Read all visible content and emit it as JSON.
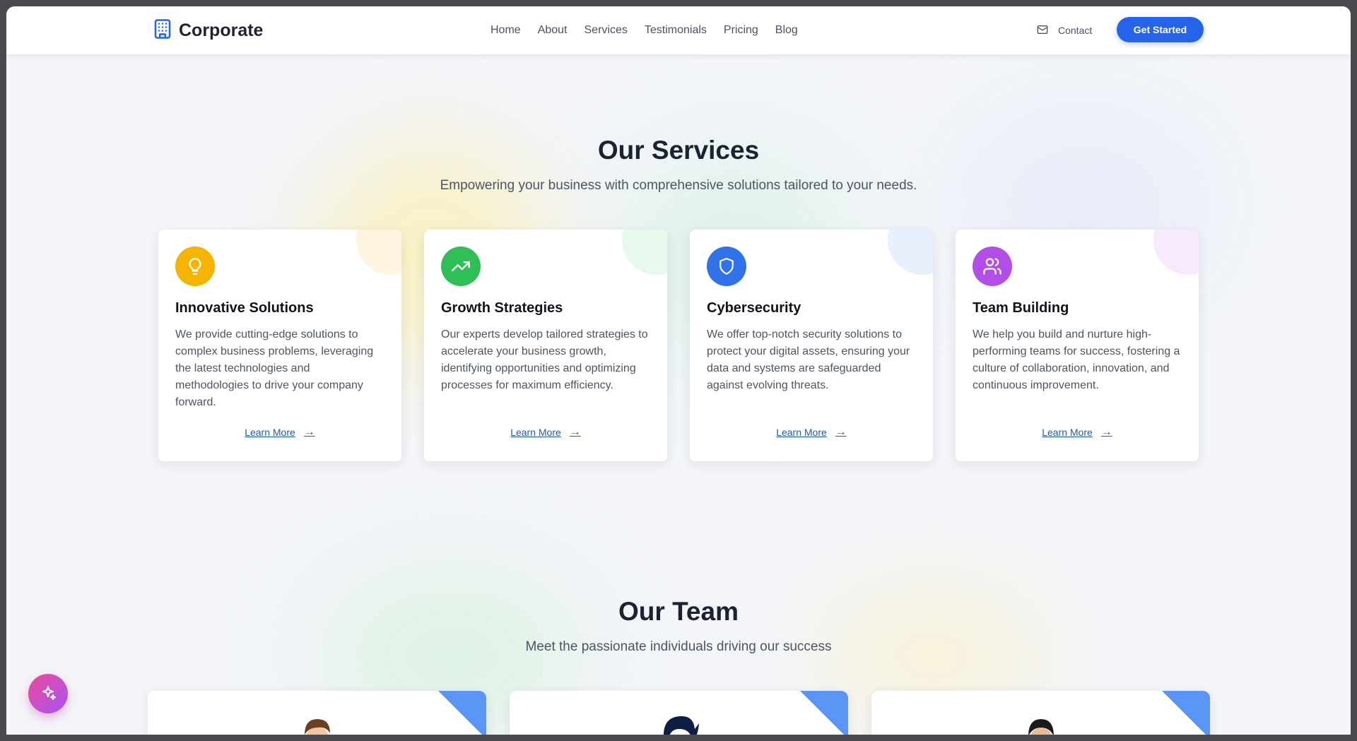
{
  "brand": {
    "name": "Corporate",
    "icon": "building-icon"
  },
  "nav": [
    {
      "label": "Home"
    },
    {
      "label": "About"
    },
    {
      "label": "Services"
    },
    {
      "label": "Testimonials"
    },
    {
      "label": "Pricing"
    },
    {
      "label": "Blog"
    }
  ],
  "contact": {
    "label": "Contact",
    "icon": "mail-icon"
  },
  "cta": {
    "label": "Get Started"
  },
  "services": {
    "title": "Our Services",
    "subtitle": "Empowering your business with comprehensive solutions tailored to your needs.",
    "cards": [
      {
        "icon": "lightbulb-icon",
        "color": "#f5b400",
        "title": "Innovative Solutions",
        "description": "We provide cutting-edge solutions to complex business problems, leveraging the latest technologies and methodologies to drive your company forward.",
        "link": "Learn More"
      },
      {
        "icon": "trending-up-icon",
        "color": "#2fbf57",
        "title": "Growth Strategies",
        "description": "Our experts develop tailored strategies to accelerate your business growth, identifying opportunities and optimizing processes for maximum efficiency.",
        "link": "Learn More"
      },
      {
        "icon": "shield-icon",
        "color": "#2f72ea",
        "title": "Cybersecurity",
        "description": "We offer top-notch security solutions to protect your digital assets, ensuring your data and systems are safeguarded against evolving threats.",
        "link": "Learn More"
      },
      {
        "icon": "users-icon",
        "color": "#b14ee8",
        "title": "Team Building",
        "description": "We help you build and nurture high-performing teams for success, fostering a culture of collaboration, innovation, and continuous improvement.",
        "link": "Learn More"
      }
    ]
  },
  "team": {
    "title": "Our Team",
    "subtitle": "Meet the passionate individuals driving our success"
  },
  "fab": {
    "icon": "sparkles-icon"
  }
}
